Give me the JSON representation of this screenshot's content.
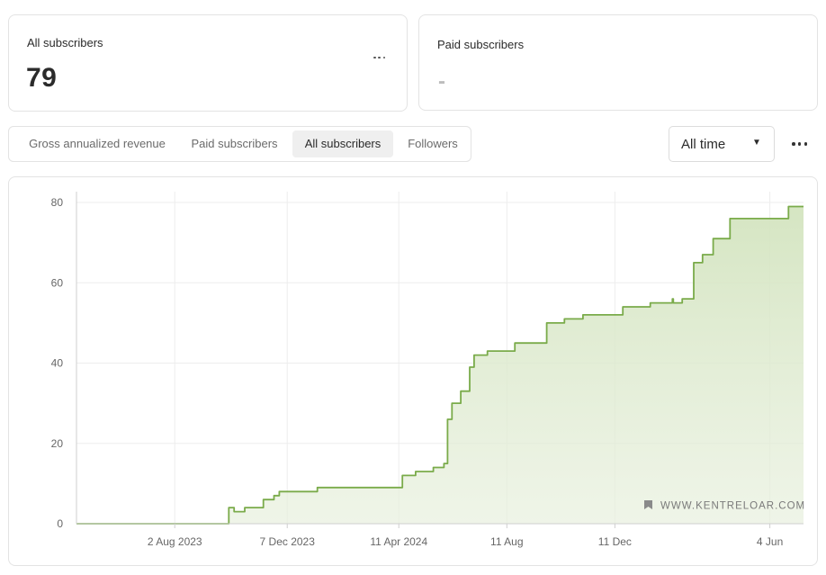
{
  "summary": {
    "all_subscribers": {
      "title": "All subscribers",
      "value": "79"
    },
    "paid_subscribers": {
      "title": "Paid subscribers",
      "value": "-"
    }
  },
  "tabs": [
    {
      "label": "Gross annualized revenue",
      "active": false
    },
    {
      "label": "Paid subscribers",
      "active": false
    },
    {
      "label": "All subscribers",
      "active": true
    },
    {
      "label": "Followers",
      "active": false
    }
  ],
  "range_select": {
    "value": "All time"
  },
  "watermark": "WWW.KENTRELOAR.COM",
  "colors": {
    "line": "#7aab4a",
    "fill": "#d7e6c4",
    "grid": "#ededed",
    "tab_active_bg": "#efefef"
  },
  "chart_data": {
    "type": "area",
    "title": "",
    "xlabel": "",
    "ylabel": "",
    "ylim": [
      0,
      80
    ],
    "grid": true,
    "yticks": [
      0,
      20,
      40,
      60,
      80
    ],
    "xticks": [
      "2 Aug 2023",
      "7 Dec 2023",
      "11 Apr 2024",
      "11 Aug",
      "11 Dec",
      "4 Jun"
    ],
    "xlim": [
      "2023-04-13",
      "2025-07-12"
    ],
    "series": [
      {
        "x": [
          "2023-04-13",
          "2023-10-01",
          "2023-10-02",
          "2023-10-08",
          "2023-10-20",
          "2023-11-10",
          "2023-11-22",
          "2023-11-28",
          "2023-12-05",
          "2024-01-10",
          "2024-03-30",
          "2024-04-15",
          "2024-04-20",
          "2024-04-30",
          "2024-05-20",
          "2024-06-01",
          "2024-06-05",
          "2024-06-10",
          "2024-06-20",
          "2024-06-30",
          "2024-07-05",
          "2024-07-20",
          "2024-08-20",
          "2024-09-10",
          "2024-09-25",
          "2024-10-15",
          "2024-11-05",
          "2024-12-20",
          "2025-01-05",
          "2025-01-20",
          "2025-02-14",
          "2025-02-15",
          "2025-02-25",
          "2025-03-10",
          "2025-03-20",
          "2025-04-01",
          "2025-04-20",
          "2025-06-25",
          "2025-07-12"
        ],
        "y": [
          0,
          0,
          4,
          3,
          4,
          6,
          7,
          8,
          8,
          9,
          9,
          12,
          12,
          13,
          14,
          15,
          26,
          30,
          33,
          39,
          42,
          43,
          45,
          45,
          50,
          51,
          52,
          54,
          54,
          55,
          56,
          55,
          56,
          65,
          67,
          71,
          76,
          79,
          79
        ]
      }
    ]
  }
}
